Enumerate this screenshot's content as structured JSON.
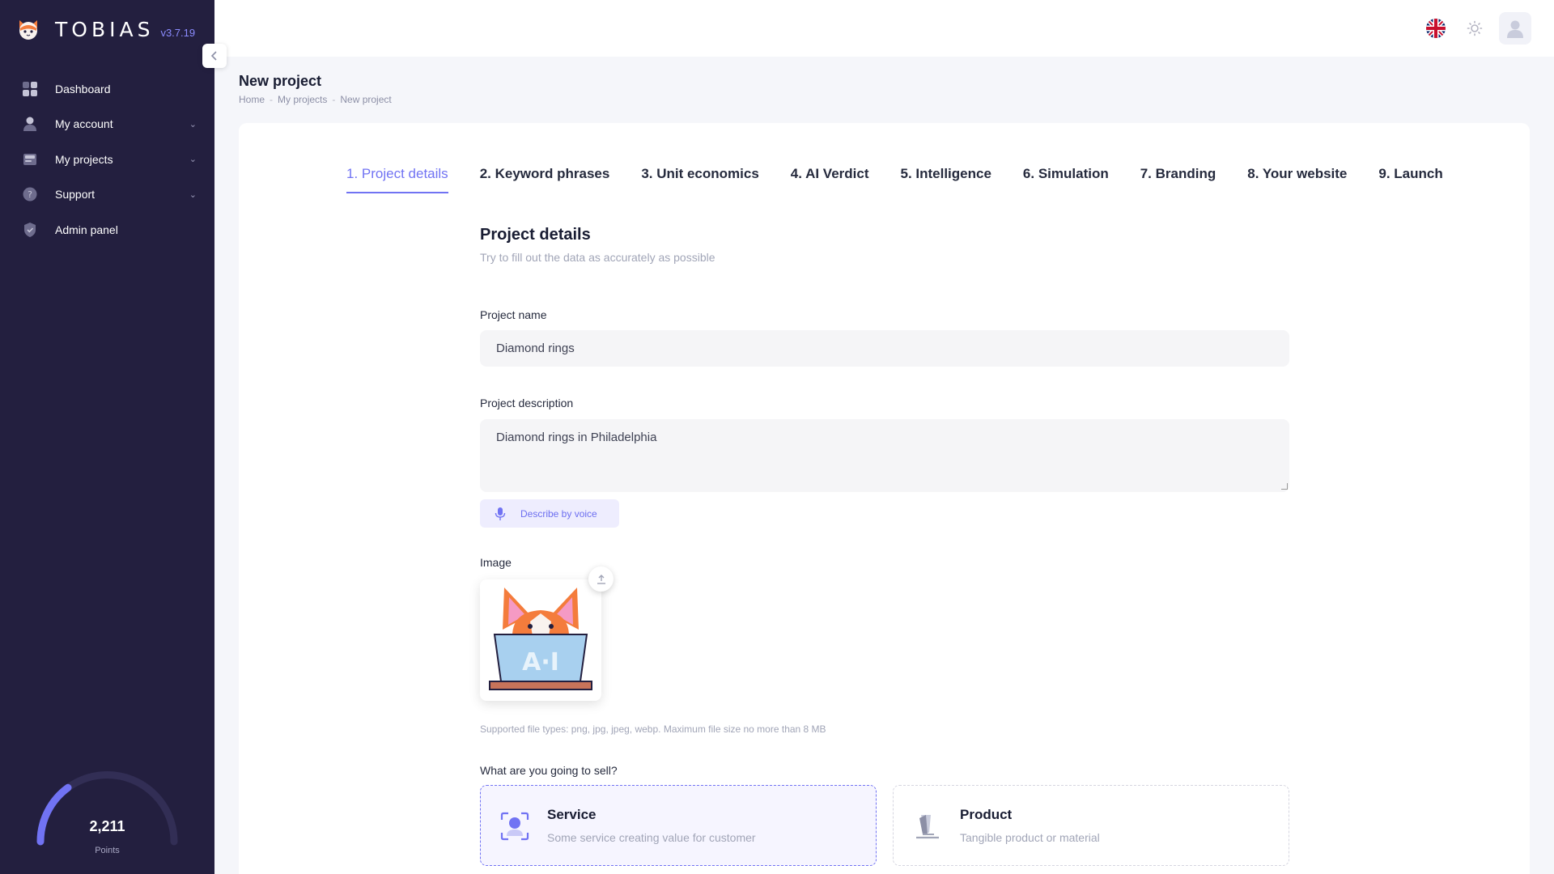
{
  "brand": {
    "name": "TOBIAS",
    "version": "v3.7.19"
  },
  "sidebar": {
    "items": [
      {
        "label": "Dashboard",
        "icon": "dashboard-icon",
        "has_chevron": false
      },
      {
        "label": "My account",
        "icon": "user-icon",
        "has_chevron": true
      },
      {
        "label": "My projects",
        "icon": "projects-icon",
        "has_chevron": true
      },
      {
        "label": "Support",
        "icon": "question-icon",
        "has_chevron": true
      },
      {
        "label": "Admin panel",
        "icon": "shield-icon",
        "has_chevron": false
      }
    ],
    "points": {
      "value": "2,211",
      "label": "Points",
      "fraction": 0.3
    }
  },
  "header": {
    "language": "English (UK flag)",
    "theme_icon": "sun-icon",
    "avatar_icon": "user-avatar-icon"
  },
  "toolbar": {
    "title": "New project",
    "breadcrumb": [
      "Home",
      "My projects",
      "New project"
    ]
  },
  "tabs": [
    {
      "label": "1. Project details",
      "active": true
    },
    {
      "label": "2. Keyword phrases",
      "active": false
    },
    {
      "label": "3. Unit economics",
      "active": false
    },
    {
      "label": "4. AI Verdict",
      "active": false
    },
    {
      "label": "5. Intelligence",
      "active": false
    },
    {
      "label": "6. Simulation",
      "active": false
    },
    {
      "label": "7. Branding",
      "active": false
    },
    {
      "label": "8. Your website",
      "active": false
    },
    {
      "label": "9. Launch",
      "active": false
    }
  ],
  "form": {
    "title": "Project details",
    "subtitle": "Try to fill out the data as accurately as possible",
    "name_label": "Project name",
    "name_value": "Diamond rings",
    "description_label": "Project description",
    "description_value": "Diamond rings in Philadelphia",
    "voice_button": "Describe by voice",
    "image_label": "Image",
    "image_text": "A·I",
    "image_hint": "Supported file types: png, jpg, jpeg, webp. Maximum file size no more than 8 MB",
    "sell_label": "What are you going to sell?",
    "options": [
      {
        "title": "Service",
        "subtitle": "Some service creating value for customer",
        "selected": true
      },
      {
        "title": "Product",
        "subtitle": "Tangible product or material",
        "selected": false
      }
    ]
  },
  "colors": {
    "sidebar_bg": "#231f3f",
    "accent": "#7173f3",
    "page_bg": "#f5f6fa"
  }
}
